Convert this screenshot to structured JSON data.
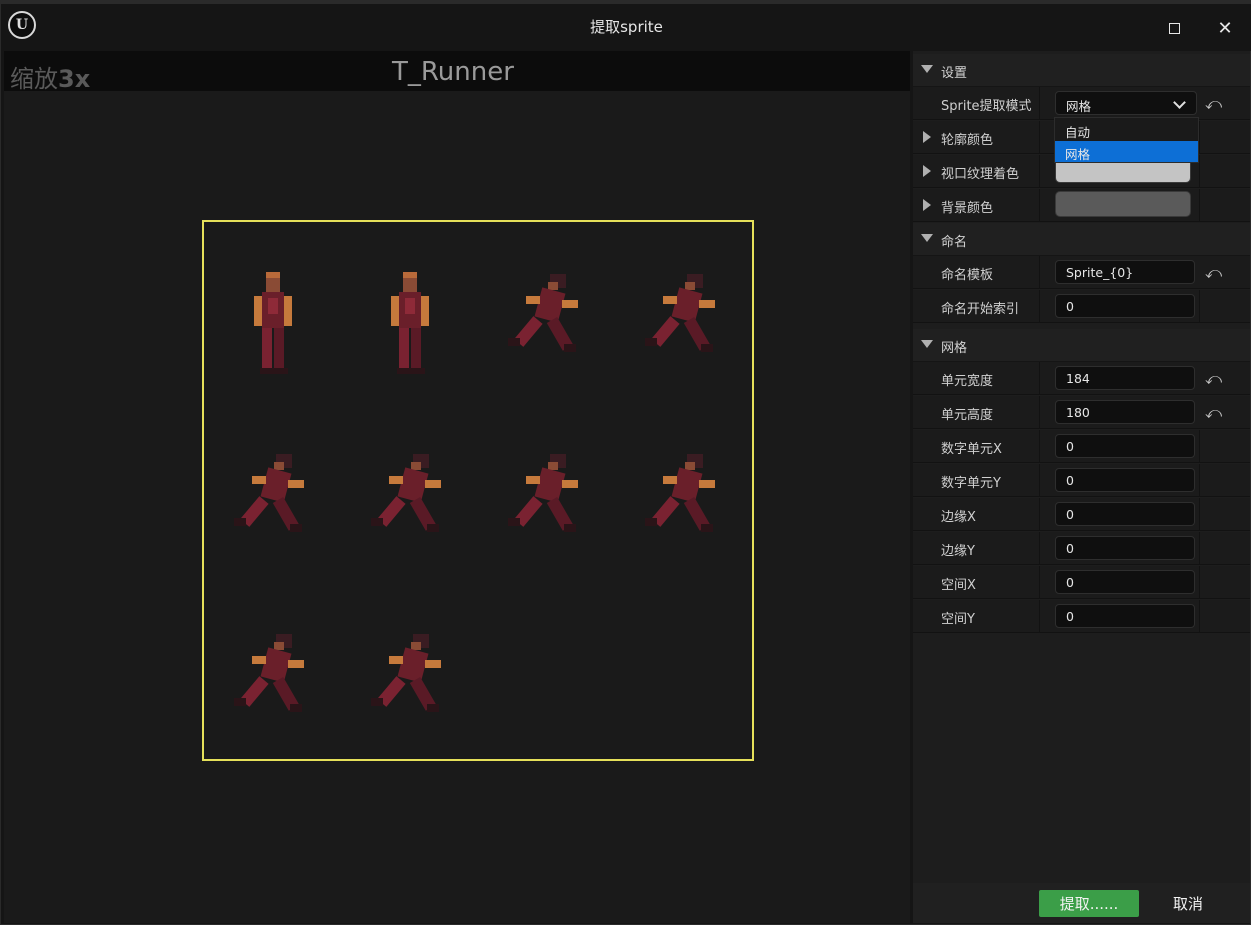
{
  "window": {
    "title": "提取sprite",
    "logo_letter": "U",
    "maximize_icon": "maximize-icon",
    "close_glyph": "✕"
  },
  "viewport": {
    "zoom_prefix": "缩放",
    "zoom_value": "3x",
    "texture_name": "T_Runner",
    "grid_columns": 4,
    "grid_rows": 3,
    "frame_count": 10,
    "outline_color": "#e5e05a"
  },
  "details": {
    "settings": {
      "header": "设置",
      "mode_label": "Sprite提取模式",
      "mode_value": "网格",
      "outline_color_label": "轮廓颜色",
      "viewport_tint_label": "视口纹理着色",
      "viewport_tint_color": "#c4c4c4",
      "background_color_label": "背景颜色",
      "background_color": "#5a5a5a"
    },
    "dropdown": {
      "options": [
        "自动",
        "网格"
      ],
      "selected": "网格"
    },
    "naming": {
      "header": "命名",
      "template_label": "命名模板",
      "template_value": "Sprite_{0}",
      "start_index_label": "命名开始索引",
      "start_index_value": "0"
    },
    "grid": {
      "header": "网格",
      "rows": [
        {
          "label": "单元宽度",
          "value": "184",
          "reset": true
        },
        {
          "label": "单元高度",
          "value": "180",
          "reset": true
        },
        {
          "label": "数字单元X",
          "value": "0",
          "reset": false
        },
        {
          "label": "数字单元Y",
          "value": "0",
          "reset": false
        },
        {
          "label": "边缘X",
          "value": "0",
          "reset": false
        },
        {
          "label": "边缘Y",
          "value": "0",
          "reset": false
        },
        {
          "label": "空间X",
          "value": "0",
          "reset": false
        },
        {
          "label": "空间Y",
          "value": "0",
          "reset": false
        }
      ]
    }
  },
  "footer": {
    "extract_label": "提取......",
    "cancel_label": "取消",
    "accent": "#3b9e48"
  },
  "reset_glyph": "⤺"
}
